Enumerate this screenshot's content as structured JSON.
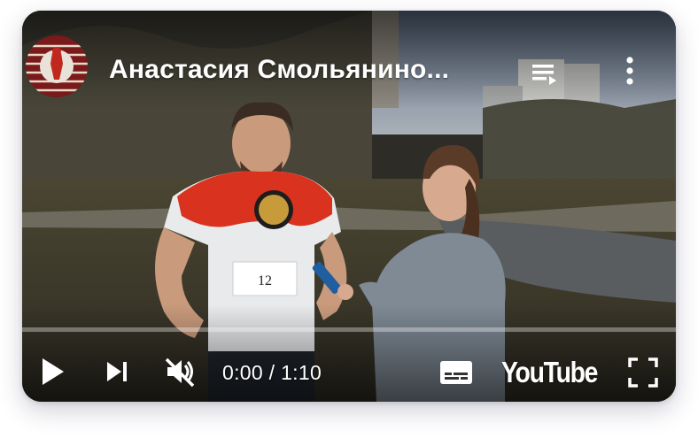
{
  "video": {
    "title": "Анастасия Смольянино...",
    "current_time": "0:00",
    "separator": "/",
    "duration": "1:10",
    "progress_fraction": 0,
    "time_display": ""
  },
  "bib": {
    "number": "12"
  },
  "branding": {
    "logo_text": "YouTube"
  },
  "icons": {
    "channel": "channel-avatar-icon",
    "playlist": "playlist-icon",
    "more": "more-vert-icon",
    "play": "play-icon",
    "next": "next-icon",
    "mute": "volume-muted-icon",
    "captions": "captions-icon",
    "fullscreen": "fullscreen-icon"
  },
  "colors": {
    "progress_played": "#ff0000",
    "controls": "#ffffff"
  }
}
